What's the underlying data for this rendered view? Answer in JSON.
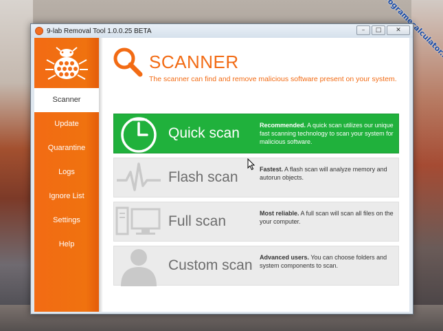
{
  "window": {
    "title": "9-lab Removal Tool 1.0.0.25 BETA",
    "controls": {
      "minimize": "–",
      "maximize": "□",
      "close": "✕"
    }
  },
  "watermark": "programecalculator.ro",
  "sidebar": {
    "items": [
      {
        "label": "Scanner",
        "active": true
      },
      {
        "label": "Update"
      },
      {
        "label": "Quarantine"
      },
      {
        "label": "Logs"
      },
      {
        "label": "Ignore List"
      },
      {
        "label": "Settings"
      },
      {
        "label": "Help"
      }
    ]
  },
  "header": {
    "title": "SCANNER",
    "subtitle": "The scanner can find and remove malicious software present on your system.",
    "icon": "magnifier-icon"
  },
  "scans": [
    {
      "label": "Quick scan",
      "desc_bold": "Recommended.",
      "desc": " A quick scan utilizes our unique fast scanning technology to scan your system for malicious software.",
      "icon": "clock-icon",
      "color": "#20b13c"
    },
    {
      "label": "Flash scan",
      "desc_bold": "Fastest.",
      "desc": " A flash scan will analyze memory and autorun objects.",
      "icon": "pulse-icon"
    },
    {
      "label": "Full scan",
      "desc_bold": "Most reliable.",
      "desc": " A full scan will scan all files on the your computer.",
      "icon": "computer-icon"
    },
    {
      "label": "Custom scan",
      "desc_bold": "Advanced users.",
      "desc": " You can choose folders and system components to scan.",
      "icon": "user-icon"
    }
  ],
  "colors": {
    "accent": "#f26b14",
    "success": "#20b13c"
  }
}
